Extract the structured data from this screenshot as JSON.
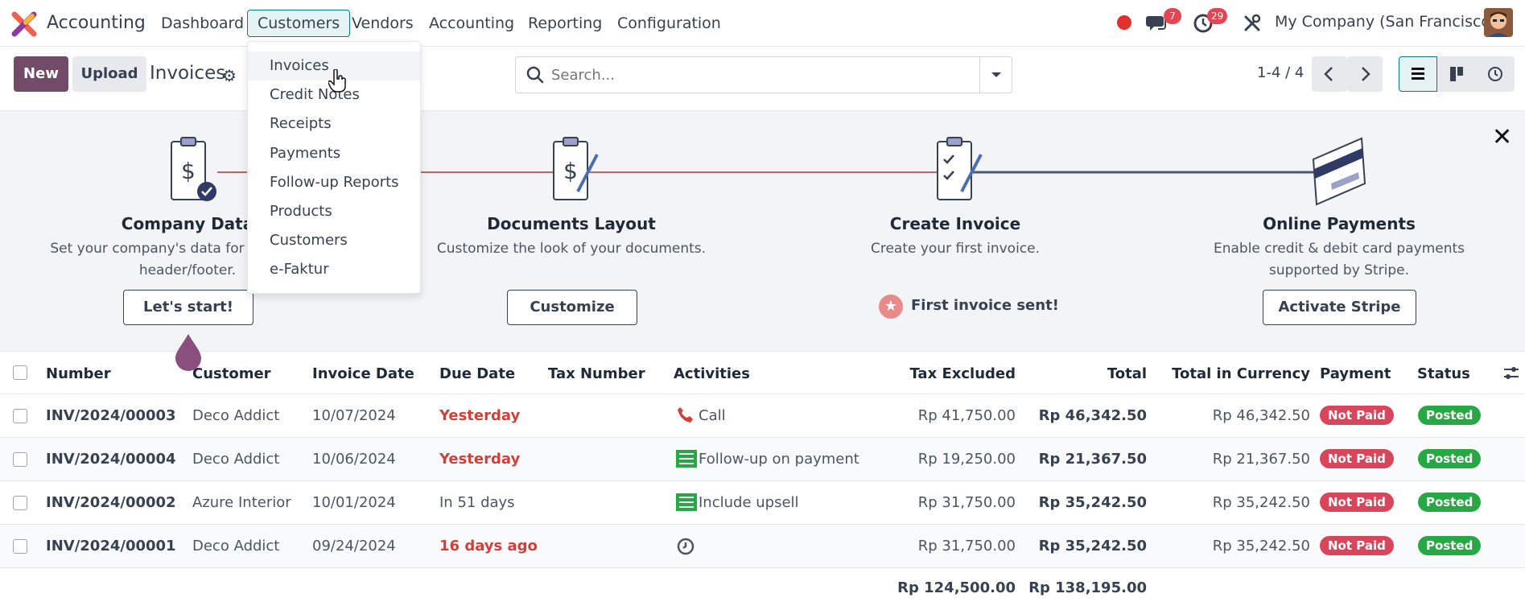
{
  "navbar": {
    "app_name": "Accounting",
    "menus": [
      "Dashboard",
      "Customers",
      "Vendors",
      "Accounting",
      "Reporting",
      "Configuration"
    ],
    "messages_count": "7",
    "activities_count": "29",
    "company": "My Company (San Francisco)"
  },
  "control": {
    "new_label": "New",
    "upload_label": "Upload",
    "breadcrumb": "Invoices",
    "search_placeholder": "Search...",
    "pager": "1-4 / 4"
  },
  "dropdown": {
    "items": [
      "Invoices",
      "Credit Notes",
      "Receipts",
      "Payments",
      "Follow-up Reports",
      "Products",
      "Customers",
      "e-Faktur"
    ]
  },
  "onboarding": {
    "steps": [
      {
        "title": "Company Data",
        "desc": "Set your company's data for documents header/footer.",
        "button": "Let's start!"
      },
      {
        "title": "Documents Layout",
        "desc": "Customize the look of your documents.",
        "button": "Customize"
      },
      {
        "title": "Create Invoice",
        "desc": "Create your first invoice.",
        "done": "First invoice sent!"
      },
      {
        "title": "Online Payments",
        "desc": "Enable credit & debit card payments supported by Stripe.",
        "button": "Activate Stripe"
      }
    ]
  },
  "table": {
    "headers": [
      "Number",
      "Customer",
      "Invoice Date",
      "Due Date",
      "Tax Number",
      "Activities",
      "Tax Excluded",
      "Total",
      "Total in Currency",
      "Payment",
      "Status"
    ],
    "rows": [
      {
        "number": "INV/2024/00003",
        "customer": "Deco Addict",
        "invoice_date": "10/07/2024",
        "due": "Yesterday",
        "activity": "Call",
        "tax_excl": "Rp 41,750.00",
        "total": "Rp 46,342.50",
        "total_cur": "Rp 46,342.50",
        "payment": "Not Paid",
        "status": "Posted"
      },
      {
        "number": "INV/2024/00004",
        "customer": "Deco Addict",
        "invoice_date": "10/06/2024",
        "due": "Yesterday",
        "activity": "Follow-up on payment",
        "tax_excl": "Rp 19,250.00",
        "total": "Rp 21,367.50",
        "total_cur": "Rp 21,367.50",
        "payment": "Not Paid",
        "status": "Posted"
      },
      {
        "number": "INV/2024/00002",
        "customer": "Azure Interior",
        "invoice_date": "10/01/2024",
        "due": "In 51 days",
        "activity": "Include upsell",
        "tax_excl": "Rp 31,750.00",
        "total": "Rp 35,242.50",
        "total_cur": "Rp 35,242.50",
        "payment": "Not Paid",
        "status": "Posted"
      },
      {
        "number": "INV/2024/00001",
        "customer": "Deco Addict",
        "invoice_date": "09/24/2024",
        "due": "16 days ago",
        "activity": "",
        "tax_excl": "Rp 31,750.00",
        "total": "Rp 35,242.50",
        "total_cur": "Rp 35,242.50",
        "payment": "Not Paid",
        "status": "Posted"
      }
    ],
    "sum_tax_excl": "Rp 124,500.00",
    "sum_total": "Rp 138,195.00"
  },
  "colors": {
    "brand": "#714b67",
    "accent": "#017e84",
    "danger": "#d23f3a",
    "success": "#28a745"
  }
}
